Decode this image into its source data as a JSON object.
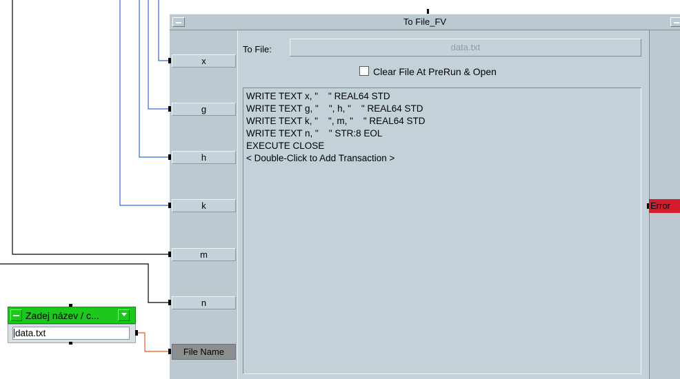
{
  "colors": {
    "wire_blue": "#3b63e0",
    "wire_black": "#000000",
    "wire_orange": "#e8591a",
    "panel": "#bcc9d1",
    "error": "#d51b2e",
    "green_title": "#1bc81b"
  },
  "main_object": {
    "title": "To File_FV",
    "to_file_label": "To File:",
    "to_file_value": "data.txt",
    "clear_file_label": "Clear File At PreRun & Open",
    "clear_file_checked": false,
    "transactions": [
      "WRITE TEXT x, \"    \" REAL64 STD",
      "WRITE TEXT g, \"    \", h, \"    \" REAL64 STD",
      "WRITE TEXT k, \"    \", m, \"    \" REAL64 STD",
      "WRITE TEXT n, \"    \" STR:8 EOL",
      "EXECUTE CLOSE",
      "< Double-Click to Add Transaction >"
    ],
    "input_pins": [
      "x",
      "g",
      "h",
      "k",
      "m",
      "n",
      "File Name"
    ],
    "output_pin": "Error"
  },
  "text_input_object": {
    "title": "Zadej název / c...",
    "value": "data.txt"
  }
}
